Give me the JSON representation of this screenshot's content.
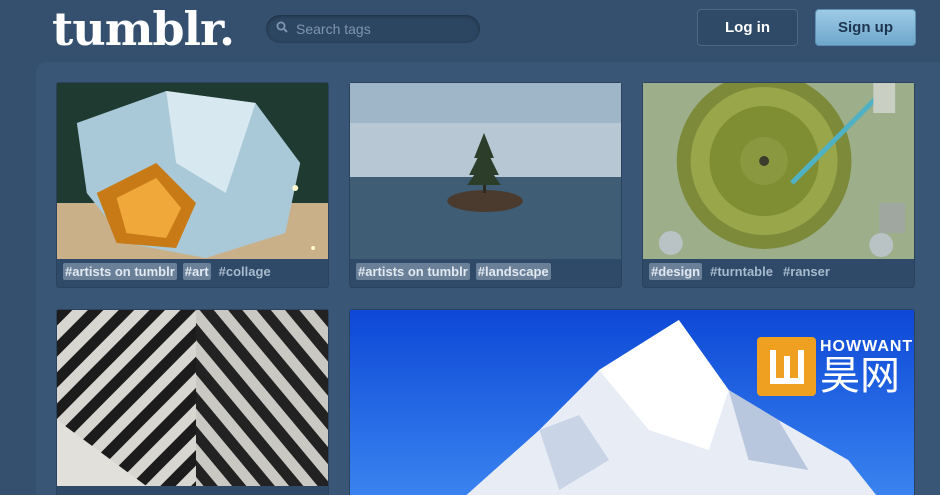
{
  "header": {
    "logo": "tumblr.",
    "search_placeholder": "Search tags",
    "login_label": "Log in",
    "signup_label": "Sign up"
  },
  "posts": [
    {
      "tags": [
        {
          "text": "#artists on tumblr",
          "highlight": true
        },
        {
          "text": "#art",
          "highlight": true
        },
        {
          "text": "#collage",
          "highlight": false
        }
      ]
    },
    {
      "tags": [
        {
          "text": "#artists on tumblr",
          "highlight": true
        },
        {
          "text": "#landscape",
          "highlight": true
        }
      ]
    },
    {
      "tags": [
        {
          "text": "#design",
          "highlight": true
        },
        {
          "text": "#turntable",
          "highlight": false
        },
        {
          "text": "#ranser",
          "highlight": false
        }
      ]
    }
  ],
  "watermark": {
    "top": "HOWWANT",
    "bottom": "昊网"
  },
  "colors": {
    "background": "#34506e",
    "panel": "#3a5677",
    "signup": "#7fb4d6"
  }
}
